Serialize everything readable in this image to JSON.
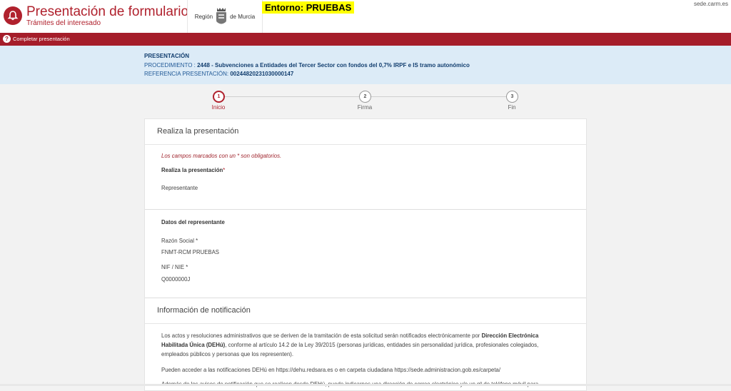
{
  "header": {
    "title": "Presentación de formulario",
    "subtitle": "Trámites del interesado",
    "region_logo": {
      "left": "Región",
      "right": "de Murcia"
    },
    "environment_badge": "Entorno: PRUEBAS",
    "site_host": "sede.carm.es",
    "brand_color": "#b0212d"
  },
  "nav_bar": {
    "help_icon": "?",
    "link": "Completar presentación"
  },
  "info": {
    "heading": "PRESENTACIÓN",
    "procedure_label": "PROCEDIMIENTO :",
    "procedure_value": "2448 - Subvenciones a Entidades del Tercer Sector con fondos del 0,7% IRPF e IS tramo autonómico",
    "reference_label": "REFERENCIA PRESENTACIÓN:",
    "reference_value": "00244820231030000147"
  },
  "steps": [
    {
      "number": "1",
      "label": "Inicio",
      "active": true
    },
    {
      "number": "2",
      "label": "Firma",
      "active": false
    },
    {
      "number": "3",
      "label": "Fin",
      "active": false
    }
  ],
  "presentation_section": {
    "title": "Realiza la presentación",
    "required_note": "Los campos marcados con un * son obligatorios.",
    "field_label": "Realiza la presentación",
    "field_required_mark": "*",
    "field_value": "Representante"
  },
  "representative_section": {
    "title": "Datos del representante",
    "company_label": "Razón Social *",
    "company_value": "FNMT-RCM PRUEBAS",
    "nif_label": "NIF / NIE *",
    "nif_value": "Q0000000J"
  },
  "notification_section": {
    "title": "Información de notificación",
    "paragraph1_before": "Los actos y resoluciones administrativos que se deriven de la tramitación de esta solicitud serán notificados electrónicamente por ",
    "paragraph1_bold": "Dirección Electrónica Habilitada Única (DEHú)",
    "paragraph1_after": ", conforme al artículo 14.2 de la Ley 39/2015 (personas jurídicas, entidades sin personalidad jurídica, profesionales colegiados, empleados públicos y personas que los representen).",
    "paragraph2": "Pueden acceder a las notificaciones DEHú en https://dehu.redsara.es o en carpeta ciudadana https://sede.administracion.gob.es/carpeta/",
    "paragraph3": "Además de los avisos de notificación que se realicen desde DEHú, puede indicarnos una dirección de correo electrónico y/o un nº de teléfono móvil para"
  }
}
